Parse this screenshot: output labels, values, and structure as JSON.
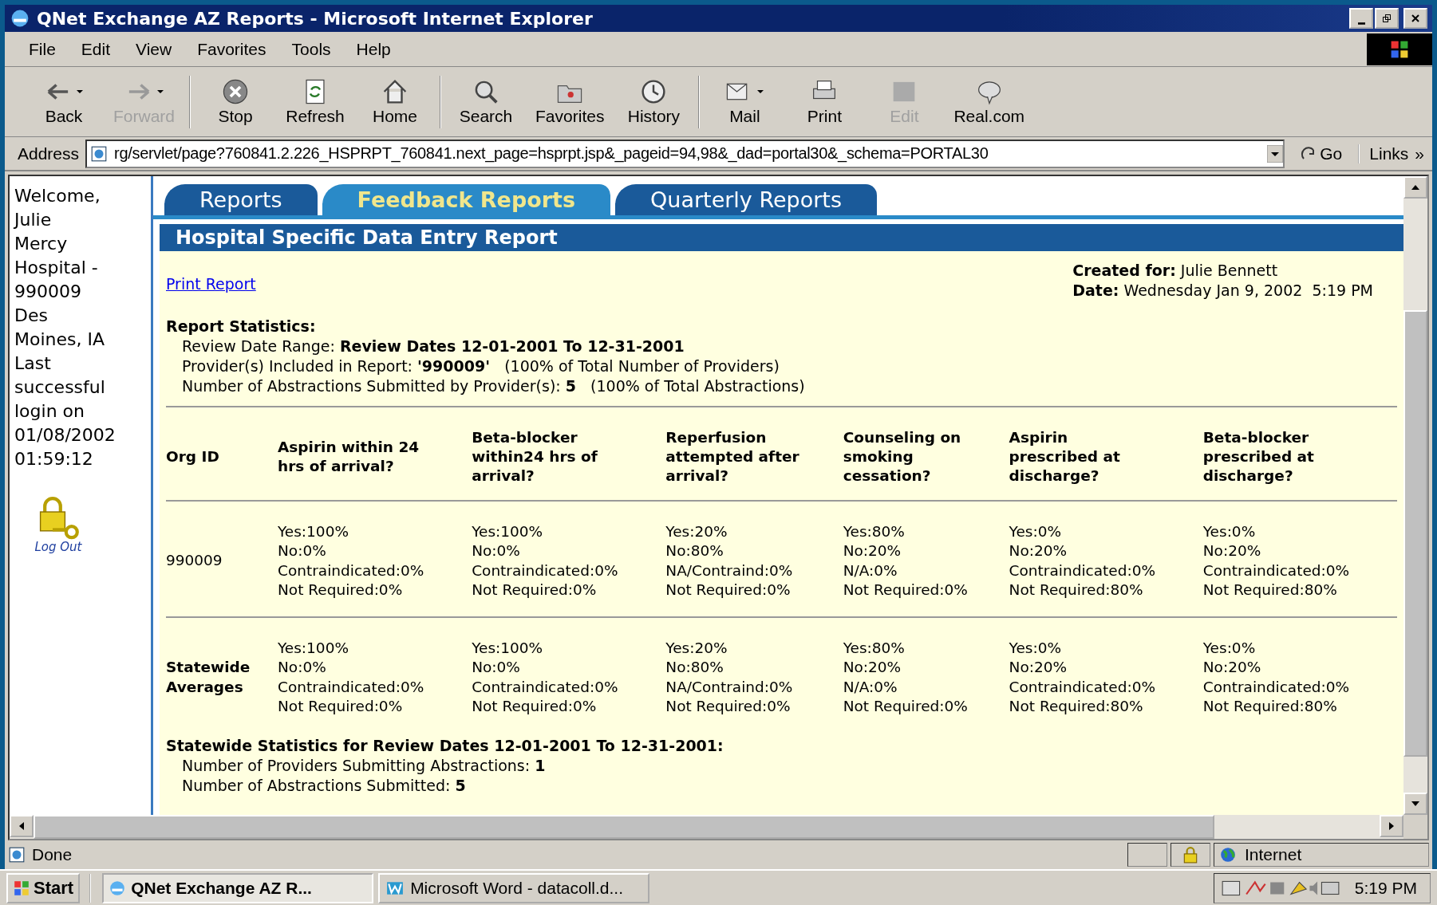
{
  "window": {
    "title": "QNet Exchange AZ Reports - Microsoft Internet Explorer"
  },
  "menu": [
    "File",
    "Edit",
    "View",
    "Favorites",
    "Tools",
    "Help"
  ],
  "toolbar": [
    {
      "label": "Back",
      "disabled": false,
      "dropdown": true
    },
    {
      "label": "Forward",
      "disabled": true,
      "dropdown": true
    },
    {
      "label": "Stop",
      "disabled": false,
      "dropdown": false
    },
    {
      "label": "Refresh",
      "disabled": false,
      "dropdown": false
    },
    {
      "label": "Home",
      "disabled": false,
      "dropdown": false
    },
    {
      "label": "Search",
      "disabled": false,
      "dropdown": false
    },
    {
      "label": "Favorites",
      "disabled": false,
      "dropdown": false
    },
    {
      "label": "History",
      "disabled": false,
      "dropdown": false
    },
    {
      "label": "Mail",
      "disabled": false,
      "dropdown": true
    },
    {
      "label": "Print",
      "disabled": false,
      "dropdown": false
    },
    {
      "label": "Edit",
      "disabled": true,
      "dropdown": false
    },
    {
      "label": "Real.com",
      "disabled": false,
      "dropdown": false
    }
  ],
  "address_bar": {
    "label": "Address",
    "value": "rg/servlet/page?760841.2.226_HSPRPT_760841.next_page=hsprpt.jsp&_pageid=94,98&_dad=portal30&_schema=PORTAL30",
    "go": "Go",
    "links": "Links",
    "more": "»"
  },
  "sidebar": {
    "welcome_lines": [
      "Welcome,",
      "Julie",
      "Mercy",
      "Hospital -",
      "990009",
      "Des",
      "Moines, IA",
      "Last",
      "successful",
      "login on",
      "01/08/2002",
      "01:59:12"
    ],
    "logout": "Log Out"
  },
  "tabs": [
    {
      "label": "Reports",
      "selected": false
    },
    {
      "label": "Feedback Reports",
      "selected": true
    },
    {
      "label": "Quarterly Reports",
      "selected": false
    }
  ],
  "report": {
    "title": "Hospital Specific Data Entry Report",
    "print_link": "Print Report",
    "created_for": {
      "label": "Created for:",
      "value": "Julie Bennett"
    },
    "date": {
      "label": "Date:",
      "value": "Wednesday Jan 9, 2002  5:19 PM"
    },
    "stats_heading": "Report Statistics:",
    "stats_lines": [
      "Review Date Range: **Review Dates 12-01-2001 To 12-31-2001**",
      "Provider(s) Included in Report: **'990009'**   (100% of Total Number of Providers)",
      "Number of Abstractions Submitted by Provider(s): **5**   (100% of Total Abstractions)"
    ],
    "table": {
      "columns": [
        "Org ID",
        "Aspirin within 24\nhrs of arrival?",
        "Beta-blocker\nwithin24 hrs of\narrival?",
        "Reperfusion\nattempted after\narrival?",
        "Counseling on\nsmoking\ncessation?",
        "Aspirin\nprescribed at\ndischarge?",
        "Beta-blocker\nprescribed at\ndischarge?"
      ],
      "rows": [
        {
          "label_bold": false,
          "cells": [
            "990009",
            "Yes:100%\nNo:0%\nContraindicated:0%\nNot Required:0%",
            "Yes:100%\nNo:0%\nContraindicated:0%\nNot Required:0%",
            "Yes:20%\nNo:80%\nNA/Contraind:0%\nNot Required:0%",
            "Yes:80%\nNo:20%\nN/A:0%\nNot Required:0%",
            "Yes:0%\nNo:20%\nContraindicated:0%\nNot Required:80%",
            "Yes:0%\nNo:20%\nContraindicated:0%\nNot Required:80%"
          ]
        },
        {
          "label_bold": true,
          "cells": [
            "Statewide\nAverages",
            "Yes:100%\nNo:0%\nContraindicated:0%\nNot Required:0%",
            "Yes:100%\nNo:0%\nContraindicated:0%\nNot Required:0%",
            "Yes:20%\nNo:80%\nNA/Contraind:0%\nNot Required:0%",
            "Yes:80%\nNo:20%\nN/A:0%\nNot Required:0%",
            "Yes:0%\nNo:20%\nContraindicated:0%\nNot Required:80%",
            "Yes:0%\nNo:20%\nContraindicated:0%\nNot Required:80%"
          ]
        }
      ]
    },
    "statewide_heading": "Statewide Statistics for Review Dates 12-01-2001 To 12-31-2001:",
    "statewide_lines": [
      "Number of Providers Submitting Abstractions: **1**",
      "Number of Abstractions Submitted: **5**"
    ]
  },
  "status_bar": {
    "text": "Done",
    "zone": "Internet"
  },
  "taskbar": {
    "start": "Start",
    "tasks": [
      {
        "label": "QNet Exchange AZ R...",
        "selected": true
      },
      {
        "label": "Microsoft Word - datacoll.d...",
        "selected": false
      }
    ],
    "clock": "5:19 PM"
  }
}
